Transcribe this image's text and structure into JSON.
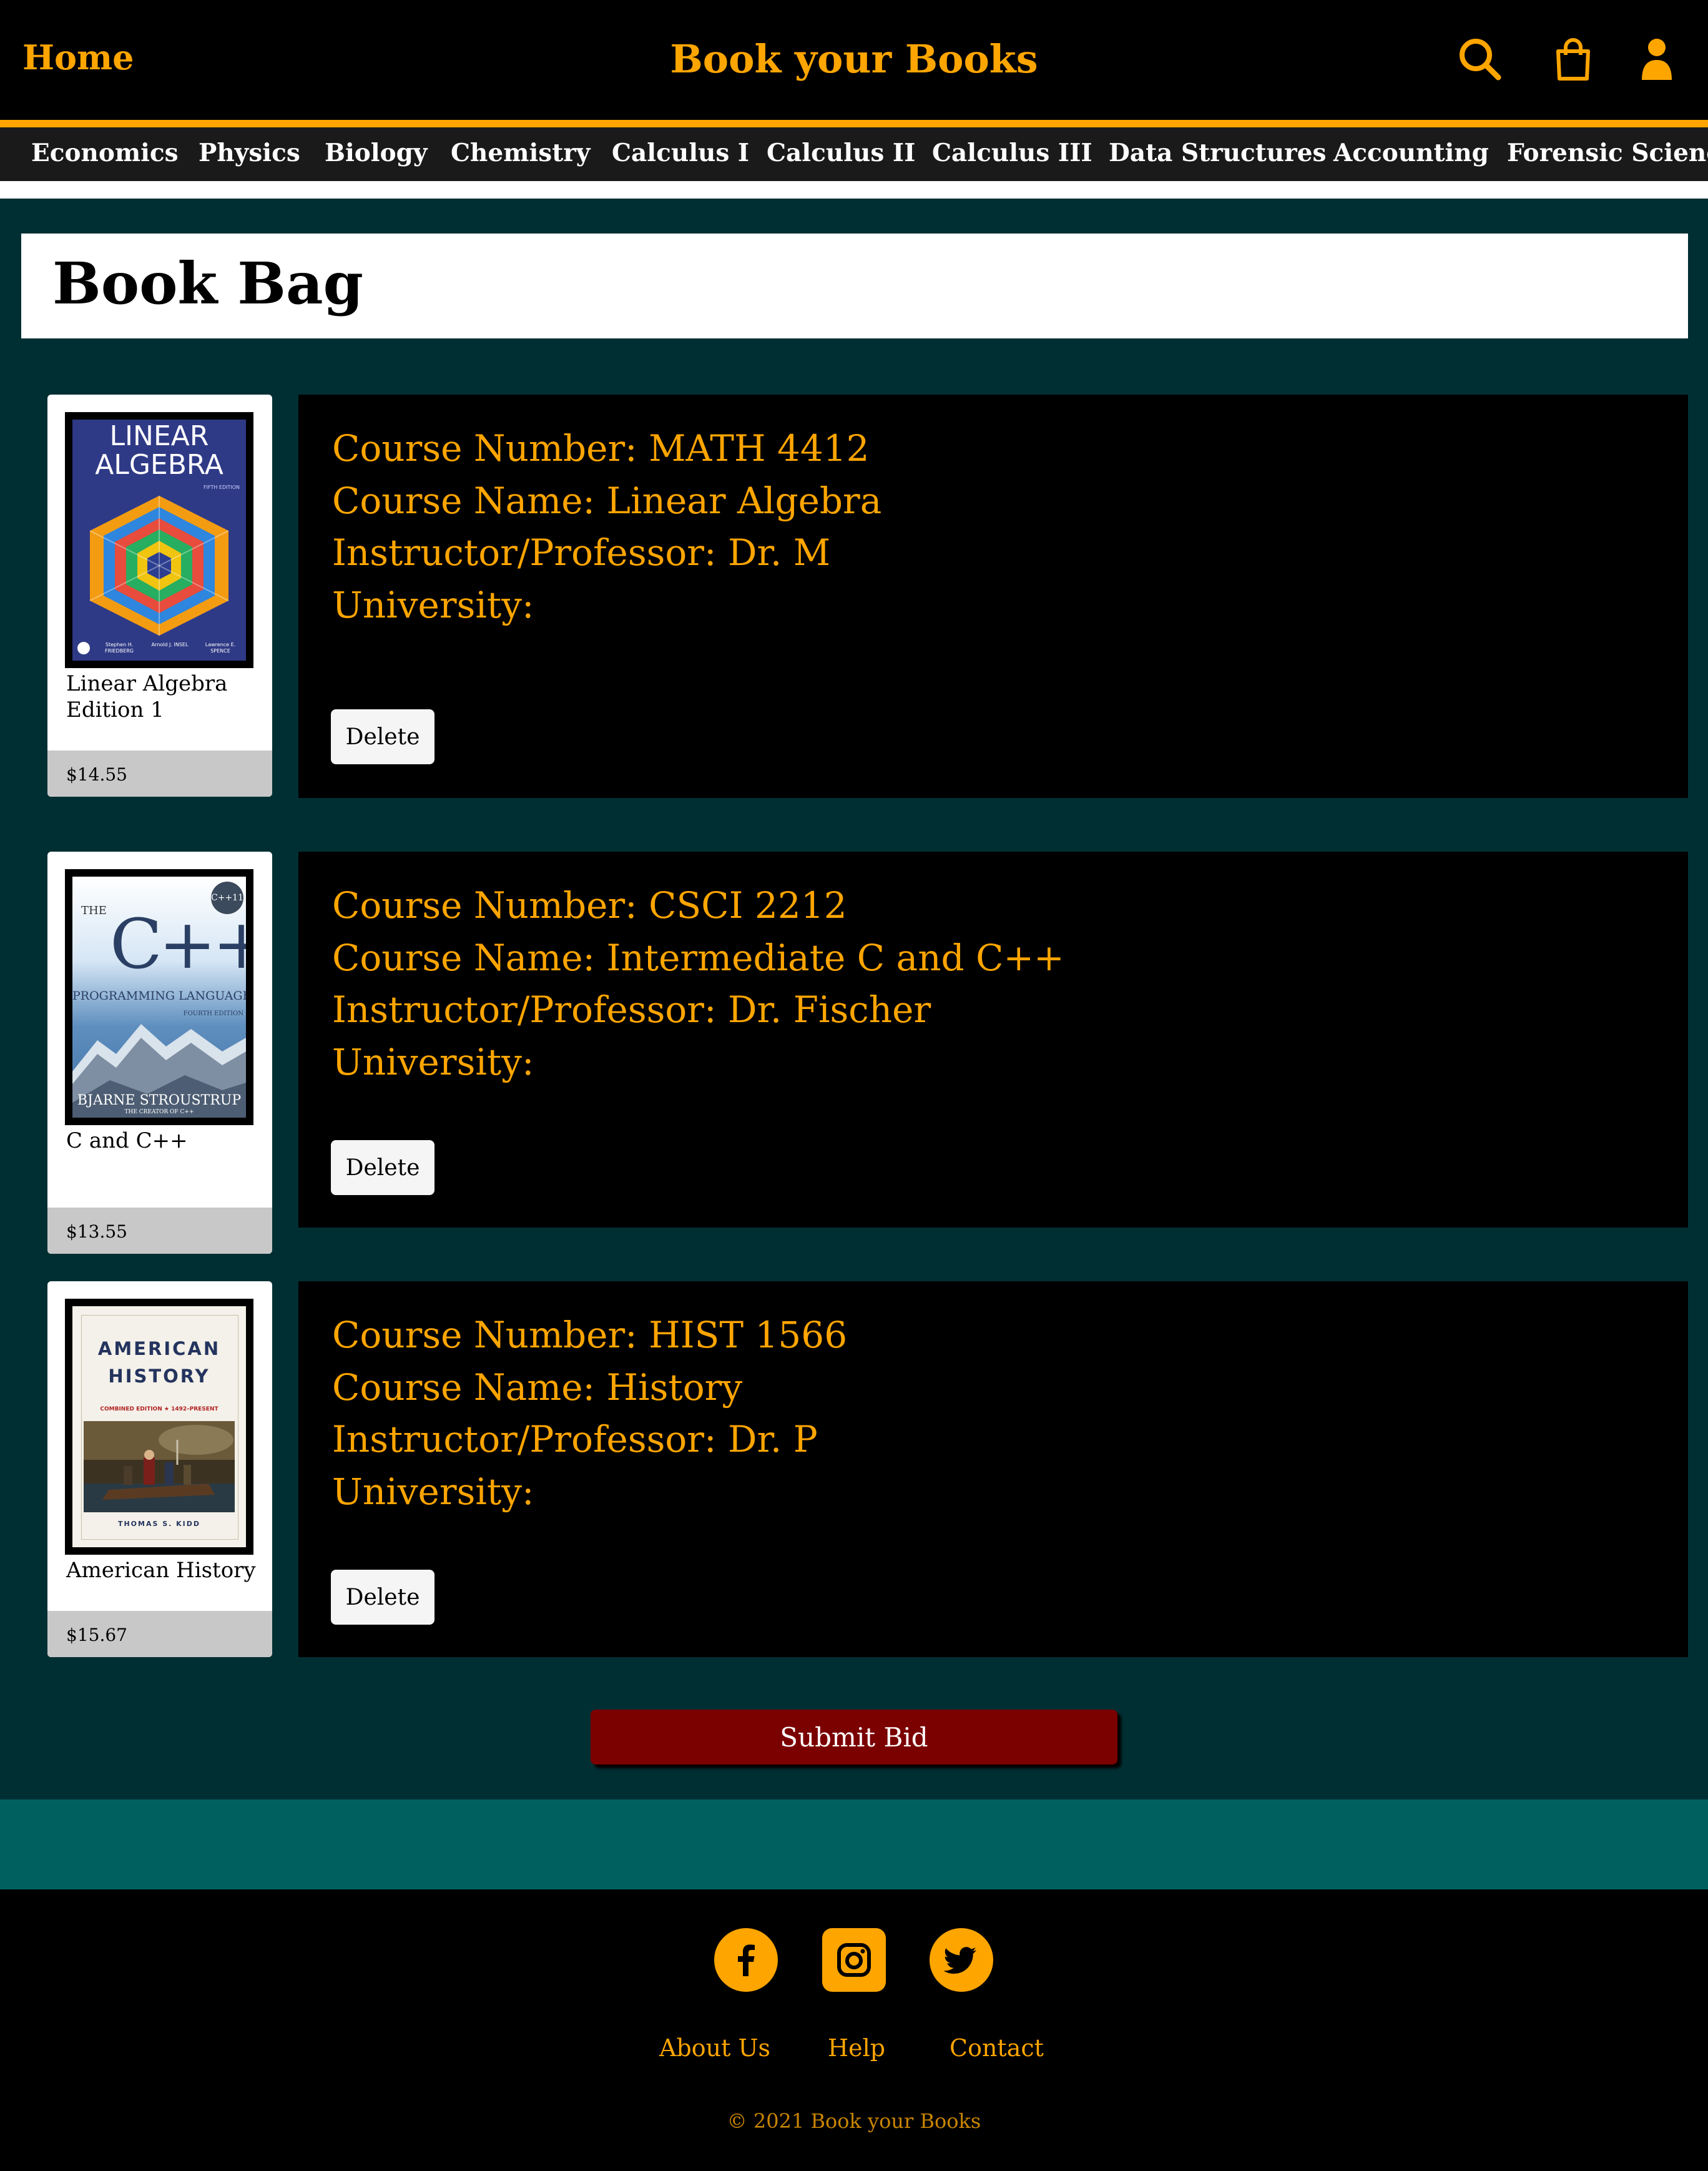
{
  "header": {
    "home_label": "Home",
    "site_title": "Book your Books",
    "icons": [
      "search-icon",
      "shopping-bag-icon",
      "user-icon"
    ],
    "accent_color": "#ffa500"
  },
  "categories": [
    "Economics",
    "Physics",
    "Biology",
    "Chemistry",
    "Calculus I",
    "Calculus II",
    "Calculus III",
    "Data Structures",
    "Accounting",
    "Forensic Science"
  ],
  "bag": {
    "title": "Book Bag",
    "items": [
      {
        "book_name": "Linear Algebra Edition 1",
        "price": "$14.55",
        "cover": {
          "line1": "LINEAR",
          "line2": "ALGEBRA",
          "edition": "FIFTH EDITION",
          "authors": [
            "Stephen H. FRIEDBERG",
            "Arnold J. INSEL",
            "Lawrence E. SPENCE"
          ]
        },
        "course_number": "Course Number: MATH 4412",
        "course_name": "Course Name: Linear Algebra",
        "instructor": "Instructor/Professor: Dr. M",
        "university": "University:",
        "delete_label": "Delete"
      },
      {
        "book_name": "C and C++",
        "price": "$13.55",
        "cover": {
          "the": "THE",
          "title": "C++",
          "subtitle": "PROGRAMMING LANGUAGE",
          "edition": "FOURTH EDITION",
          "badge": "C++11",
          "author": "BJARNE STROUSTRUP",
          "author_sub": "THE CREATOR OF C++"
        },
        "course_number": "Course Number: CSCI 2212",
        "course_name": "Course Name: Intermediate C and C++",
        "instructor": "Instructor/Professor: Dr. Fischer",
        "university": "University:",
        "delete_label": "Delete"
      },
      {
        "book_name": "American History",
        "price": "$15.67",
        "cover": {
          "line1": "AMERICAN",
          "line2": "HISTORY",
          "edition": "COMBINED EDITION ★ 1492–PRESENT",
          "author": "THOMAS S. KIDD"
        },
        "course_number": "Course Number: HIST 1566",
        "course_name": "Course Name: History",
        "instructor": "Instructor/Professor: Dr. P",
        "university": "University:",
        "delete_label": "Delete"
      }
    ],
    "submit_label": "Submit Bid"
  },
  "footer": {
    "social_icons": [
      "facebook-icon",
      "instagram-icon",
      "twitter-icon"
    ],
    "links": [
      "About Us",
      "Help",
      "Contact"
    ],
    "copyright": "© 2021 Book your Books"
  }
}
